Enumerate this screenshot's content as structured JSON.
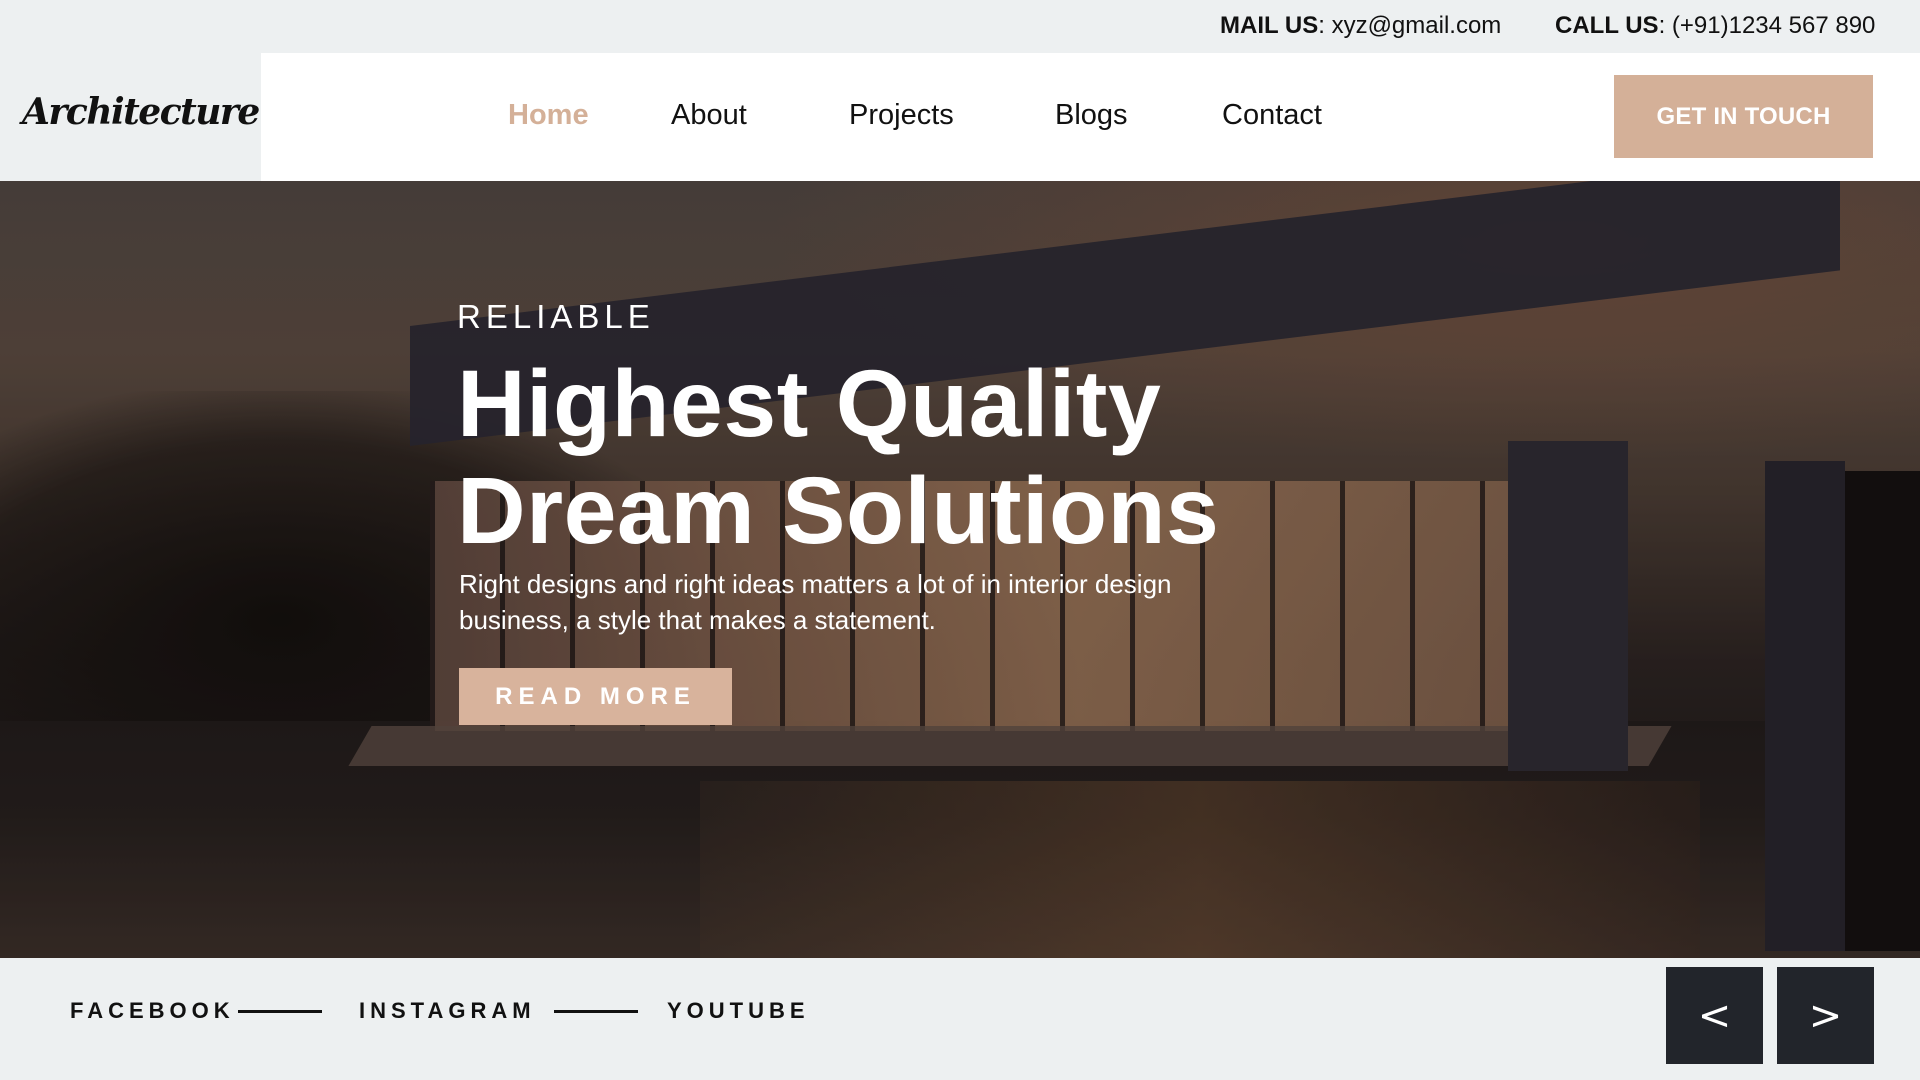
{
  "topbar": {
    "mail_label": "MAIL US",
    "mail_value": ": xyz@gmail.com",
    "call_label": "CALL US",
    "call_value": ": (+91)1234 567 890"
  },
  "nav": {
    "logo": "Architecture",
    "links": [
      {
        "label": "Home",
        "active": true
      },
      {
        "label": "About",
        "active": false
      },
      {
        "label": "Projects",
        "active": false
      },
      {
        "label": "Blogs",
        "active": false
      },
      {
        "label": "Contact",
        "active": false
      }
    ],
    "cta_label": "GET IN TOUCH"
  },
  "hero": {
    "eyebrow": "RELIABLE",
    "headline_line1": "Highest Quality",
    "headline_line2": "Dream Solutions",
    "description": "Right designs and right ideas matters a lot of in interior design business, a style that makes a statement.",
    "button_label": "READ MORE",
    "background_image": "modern-house-at-sunset-with-pool"
  },
  "footer": {
    "social": [
      {
        "label": "FACEBOOK"
      },
      {
        "label": "INSTAGRAM"
      },
      {
        "label": "YOUTUBE"
      }
    ],
    "prev_label": "<",
    "next_label": ">"
  },
  "colors": {
    "accent": "#d4b098",
    "light_bg": "#edf0f1",
    "dark_button": "#22252b",
    "text": "#111111"
  }
}
